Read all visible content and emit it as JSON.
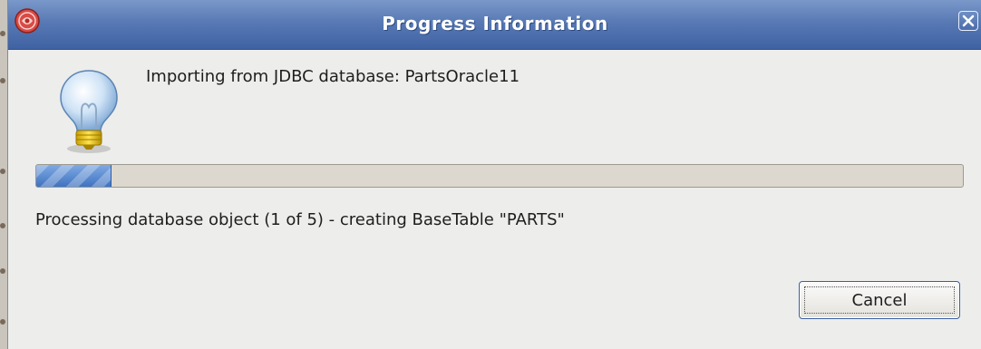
{
  "window": {
    "title": "Progress Information"
  },
  "dialog": {
    "message": "Importing from JDBC database: PartsOracle11",
    "status": "Processing database object (1 of 5) - creating BaseTable \"PARTS\"",
    "progress_fraction": 0.08
  },
  "buttons": {
    "cancel_label": "Cancel"
  },
  "icons": {
    "app": "app-logo-icon",
    "close": "close-icon",
    "info": "lightbulb-icon"
  },
  "colors": {
    "titlebar": "#5879b4",
    "progress_fill": "#4d84cf",
    "background": "#ededeb"
  }
}
